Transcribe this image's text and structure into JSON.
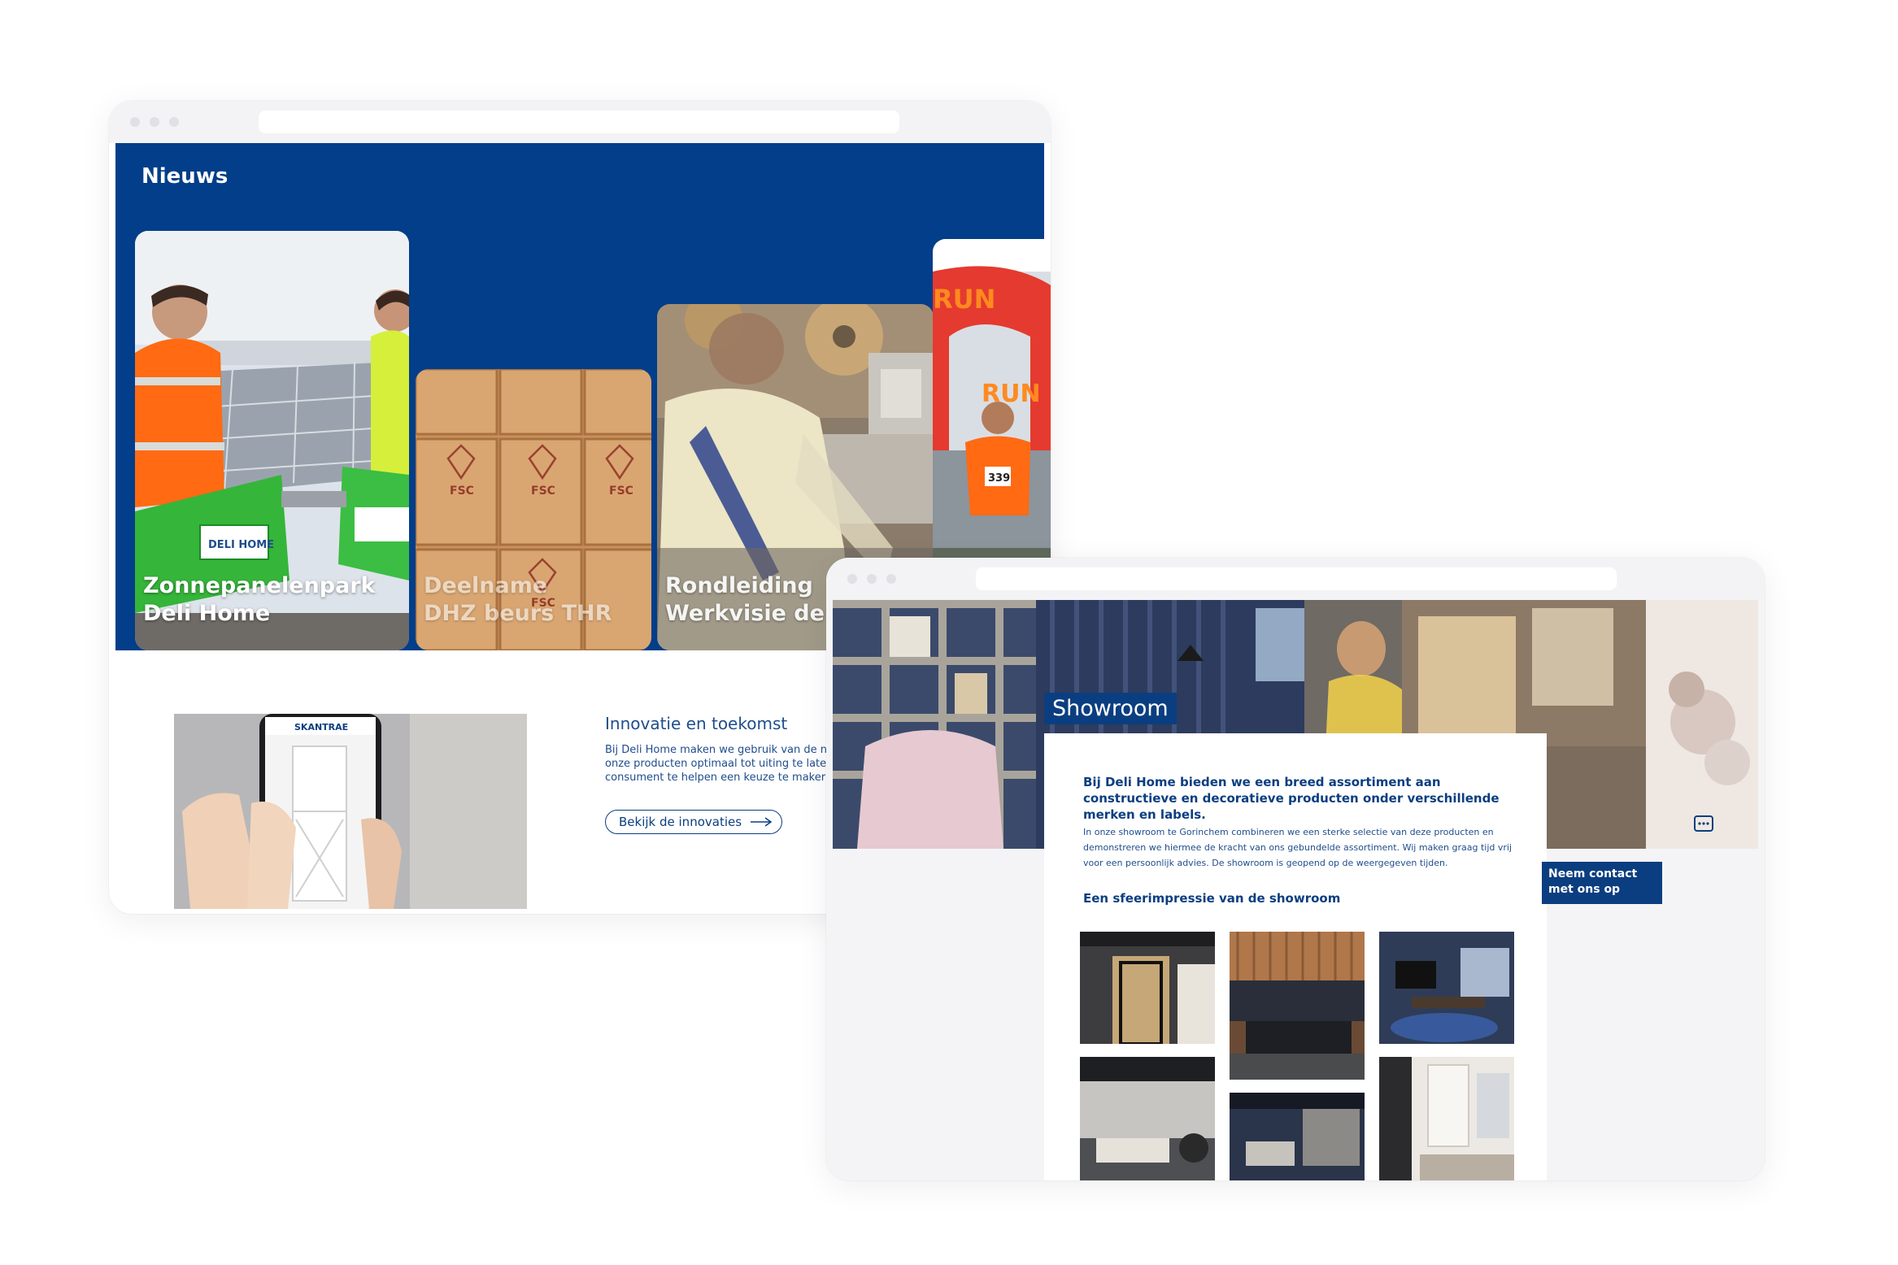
{
  "news_window": {
    "section_title": "Nieuws",
    "cards": [
      {
        "line1": "Zonnepanelenpark",
        "line2": "Deli Home",
        "sign_text": "DELI HOME"
      },
      {
        "line1": "Deelname",
        "line2": "DHZ beurs THR",
        "stamp_text": "FSC"
      },
      {
        "line1": "Rondleiding",
        "line2": "Werkvisie de Hoo"
      },
      {
        "banner_text": "RUN",
        "bib_number": "339"
      }
    ],
    "promo": {
      "phone_brand": "SKANTRAE",
      "title": "Innovatie en toekomst",
      "text": "Bij Deli Home maken we gebruik van de ni onze producten optimaal tot uiting te late consument te helpen een keuze te maker",
      "button_label": "Bekijk de innovaties"
    }
  },
  "showroom_window": {
    "tag": "Showroom",
    "lead": "Bij Deli Home bieden we een breed assortiment aan constructieve en decoratieve producten onder verschillende merken en labels.",
    "body": "In onze showroom te Gorinchem combineren we een sterke selectie van deze producten en demonstreren we hiermee de kracht van ons gebundelde assortiment. Wij maken graag tijd vrij voor een persoonlijk advies. De showroom is geopend op de weergegeven tijden.",
    "gallery_title": "Een sfeerimpressie van de showroom",
    "contact_button": "Neem contact met ons op",
    "gallery_count": 6
  },
  "colors": {
    "brand_blue": "#023e89",
    "text_blue": "#1f4d8c",
    "page_bg": "#ffffff",
    "panel_bg": "#f4f4f6"
  },
  "icons": [
    "arrow-right-icon",
    "chat-icon"
  ]
}
